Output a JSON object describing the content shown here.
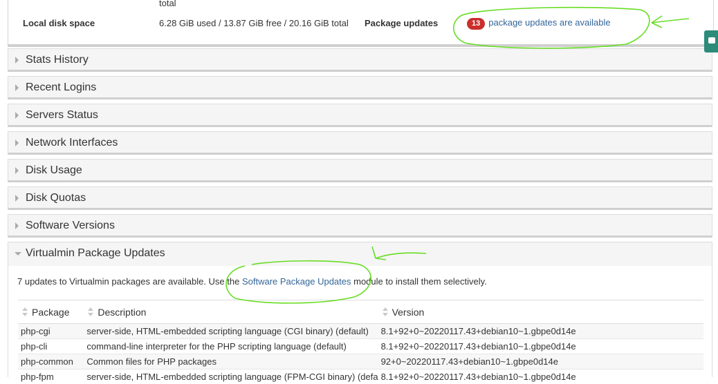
{
  "system_info": {
    "cutoff_text": "total",
    "disk_label": "Local disk space",
    "disk_value": "6.28 GiB used / 13.87 GiB free / 20.16 GiB total",
    "updates_label": "Package updates",
    "updates_count": "13",
    "updates_link": "package updates are available"
  },
  "sections": [
    {
      "title": "Stats History"
    },
    {
      "title": "Recent Logins"
    },
    {
      "title": "Servers Status"
    },
    {
      "title": "Network Interfaces"
    },
    {
      "title": "Disk Usage"
    },
    {
      "title": "Disk Quotas"
    },
    {
      "title": "Software Versions"
    }
  ],
  "open_section": {
    "title": "Virtualmin Package Updates",
    "notice_before": "7 updates to Virtualmin packages are available. Use the ",
    "notice_link": "Software Package Updates",
    "notice_after": " module to install them selectively.",
    "columns": [
      "Package",
      "Description",
      "Version"
    ],
    "rows": [
      {
        "package": "php-cgi",
        "description": "server-side, HTML-embedded scripting language (CGI binary) (default)",
        "version": "8.1+92+0~20220117.43+debian10~1.gbpe0d14e"
      },
      {
        "package": "php-cli",
        "description": "command-line interpreter for the PHP scripting language (default)",
        "version": "8.1+92+0~20220117.43+debian10~1.gbpe0d14e"
      },
      {
        "package": "php-common",
        "description": "Common files for PHP packages",
        "version": "92+0~20220117.43+debian10~1.gbpe0d14e"
      },
      {
        "package": "php-fpm",
        "description": "server-side, HTML-embedded scripting language (FPM-CGI binary) (defa",
        "version": "8.1+92+0~20220117.43+debian10~1.gbpe0d14e"
      }
    ]
  },
  "colors": {
    "badge": "#c9302c",
    "link": "#336699",
    "annotation": "#66dd22",
    "chat_tab": "#2d8b7a"
  }
}
